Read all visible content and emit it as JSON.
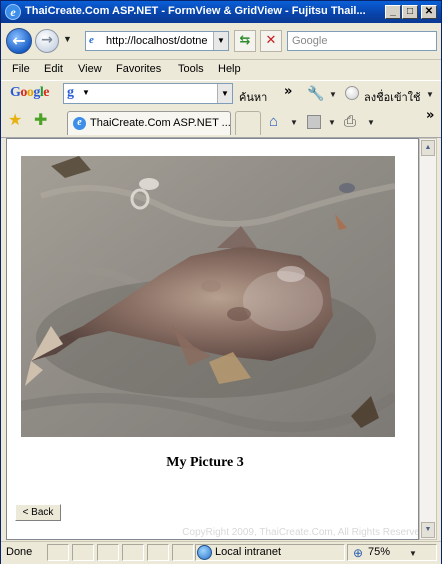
{
  "window": {
    "title": "ThaiCreate.Com ASP.NET - FormView & GridView - Fujitsu Thail...",
    "ie_logo": "e",
    "minimize": "_",
    "maximize": "□",
    "close": "✕"
  },
  "address_bar": {
    "url": "http://localhost/dotne",
    "search_placeholder": "Google"
  },
  "menu": {
    "items": [
      "File",
      "Edit",
      "View",
      "Favorites",
      "Tools",
      "Help"
    ]
  },
  "google_toolbar": {
    "logo": [
      "G",
      "o",
      "o",
      "g",
      "l",
      "e"
    ],
    "search_glyph": "g",
    "search_label": "ค้นหา",
    "more": "»",
    "signin_label": "ลงชื่อเข้าใช้"
  },
  "tabs": {
    "active_label": "ThaiCreate.Com ASP.NET ...",
    "more": "»"
  },
  "content": {
    "caption": "My Picture 3",
    "back_button": "< Back",
    "copyright": "CopyRight 2009, ThaiCreate.Com, All Rights Reserve"
  },
  "status_bar": {
    "status": "Done",
    "zone": "Local intranet",
    "zoom": "75%"
  },
  "icons": {
    "back": "back-arrow-icon",
    "forward": "forward-arrow-icon",
    "refresh": "refresh-icon",
    "stop": "stop-icon",
    "favorites": "star-icon",
    "add_favorite": "add-favorite-icon",
    "home": "home-icon",
    "feeds": "rss-icon",
    "print": "printer-icon",
    "zone": "globe-icon"
  },
  "colors": {
    "titlebar": "#0842a8",
    "page_bg": "#ffffff",
    "chrome": "#ece9d8"
  }
}
